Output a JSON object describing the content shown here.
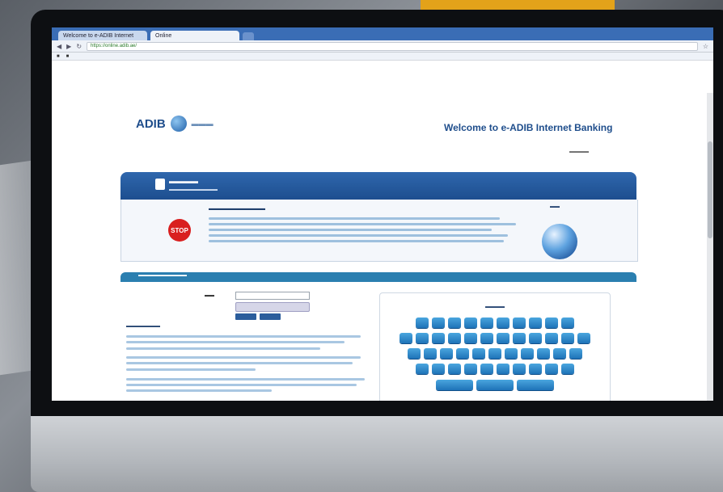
{
  "browser": {
    "tabs": [
      {
        "label": "Welcome to e-ADIB Internet"
      },
      {
        "label": "Online"
      }
    ],
    "url": "https://online.adib.ae/"
  },
  "page": {
    "logo_text": "ADIB",
    "welcome": "Welcome to e-ADIB Internet Banking",
    "login": {
      "stop_label": "STOP"
    },
    "keyboard": {
      "rows": [
        [
          "",
          "",
          "",
          "",
          "",
          "",
          "",
          "",
          "",
          ""
        ],
        [
          "",
          "",
          "",
          "",
          "",
          "",
          "",
          "",
          "",
          "",
          "",
          ""
        ],
        [
          "",
          "",
          "",
          "",
          "",
          "",
          "",
          "",
          "",
          "",
          ""
        ],
        [
          "",
          "",
          "",
          "",
          "",
          "",
          "",
          "",
          "",
          ""
        ],
        [
          "",
          "",
          ""
        ]
      ]
    }
  },
  "colors": {
    "brand_blue": "#1f4e8c",
    "header_blue": "#2f67ad",
    "key_blue": "#2a8fd0",
    "stop_red": "#d91f1f"
  },
  "icons": [
    "back-icon",
    "forward-icon",
    "reload-icon",
    "lock-icon",
    "star-icon",
    "globe-icon",
    "stop-sign-icon",
    "adib-logo-icon"
  ]
}
